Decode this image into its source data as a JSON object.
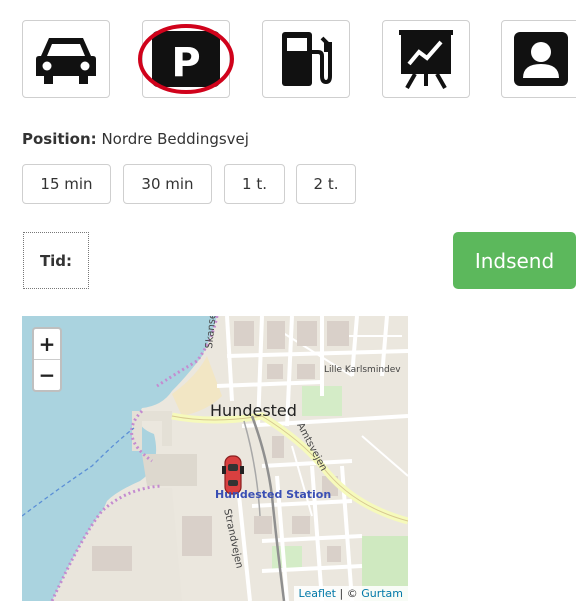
{
  "toolbar": {
    "buttons": [
      {
        "icon": "car-icon"
      },
      {
        "icon": "parking-icon",
        "selected": true
      },
      {
        "icon": "fuel-pump-icon"
      },
      {
        "icon": "presentation-chart-icon"
      },
      {
        "icon": "user-profile-icon"
      }
    ],
    "parking_letter": "P"
  },
  "position": {
    "label": "Position:",
    "value": "Nordre Beddingsvej"
  },
  "durations": [
    "15 min",
    "30 min",
    "1 t.",
    "2 t."
  ],
  "time": {
    "label": "Tid:"
  },
  "submit": {
    "label": "Indsend"
  },
  "map": {
    "zoom_in": "+",
    "zoom_out": "−",
    "labels": {
      "town": "Hundested",
      "station": "Hundested Station",
      "skansevej": "Skansevej",
      "lille": "Lille Karlsmindev",
      "amtsvejen": "Amtsvejen",
      "strandvejen": "Strandvejen"
    },
    "attribution": {
      "leaflet": "Leaflet",
      "separator": " | © ",
      "provider": "Gurtam"
    }
  },
  "colors": {
    "accent_green": "#5cb85c",
    "selection_ring": "#d0021b",
    "water": "#aad3df"
  }
}
